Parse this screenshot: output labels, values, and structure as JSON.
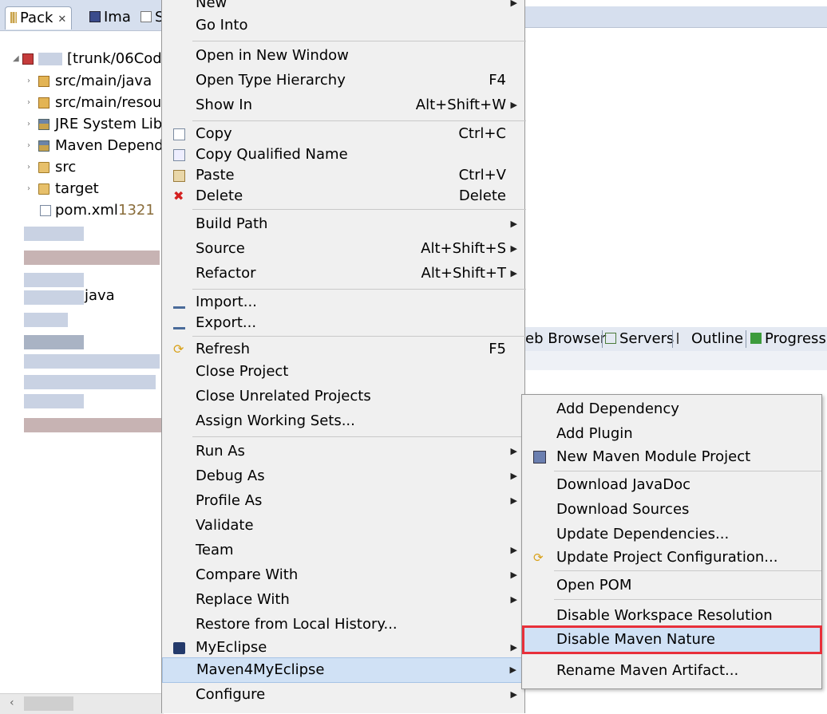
{
  "left_pane": {
    "tabs": [
      {
        "label": "Pack",
        "close": "✕"
      },
      {
        "label": "Ima"
      },
      {
        "label": "S"
      }
    ],
    "tree": [
      {
        "label": "[trunk/06Cod"
      },
      {
        "label": "src/main/java"
      },
      {
        "label": "src/main/resou"
      },
      {
        "label": "JRE System Libr"
      },
      {
        "label": "Maven Depend"
      },
      {
        "label": "src"
      },
      {
        "label": "target"
      },
      {
        "label": "pom.xml",
        "rev": "1321"
      }
    ],
    "blur_row_text": "java"
  },
  "context_menu": {
    "items": [
      {
        "label": "New"
      },
      {
        "label": "Go Into"
      },
      {
        "label": "Open in New Window"
      },
      {
        "label": "Open Type Hierarchy",
        "accel": "F4"
      },
      {
        "label": "Show In",
        "accel": "Alt+Shift+W"
      },
      {
        "label": "Copy",
        "accel": "Ctrl+C"
      },
      {
        "label": "Copy Qualified Name"
      },
      {
        "label": "Paste",
        "accel": "Ctrl+V"
      },
      {
        "label": "Delete",
        "accel": "Delete"
      },
      {
        "label": "Build Path"
      },
      {
        "label": "Source",
        "accel": "Alt+Shift+S"
      },
      {
        "label": "Refactor",
        "accel": "Alt+Shift+T"
      },
      {
        "label": "Import..."
      },
      {
        "label": "Export..."
      },
      {
        "label": "Refresh",
        "accel": "F5"
      },
      {
        "label": "Close Project"
      },
      {
        "label": "Close Unrelated Projects"
      },
      {
        "label": "Assign Working Sets..."
      },
      {
        "label": "Run As"
      },
      {
        "label": "Debug As"
      },
      {
        "label": "Profile As"
      },
      {
        "label": "Validate"
      },
      {
        "label": "Team"
      },
      {
        "label": "Compare With"
      },
      {
        "label": "Replace With"
      },
      {
        "label": "Restore from Local History..."
      },
      {
        "label": "MyEclipse"
      },
      {
        "label": "Maven4MyEclipse"
      },
      {
        "label": "Configure"
      }
    ],
    "submenu_arrow": "▶"
  },
  "submenu": {
    "items": [
      {
        "label": "Add Dependency"
      },
      {
        "label": "Add Plugin"
      },
      {
        "label": "New Maven Module Project"
      },
      {
        "label": "Download JavaDoc"
      },
      {
        "label": "Download Sources"
      },
      {
        "label": "Update Dependencies..."
      },
      {
        "label": "Update Project Configuration..."
      },
      {
        "label": "Open POM"
      },
      {
        "label": "Disable Workspace Resolution"
      },
      {
        "label": "Disable Maven Nature"
      },
      {
        "label": "Rename Maven Artifact..."
      }
    ]
  },
  "bottom_tabs": [
    {
      "label": "eb Browser"
    },
    {
      "label": "Servers"
    },
    {
      "label": "Outline"
    },
    {
      "label": "Progress"
    }
  ],
  "colors": {
    "highlight_border": "#e8303a",
    "selected_bg": "#d0e1f5"
  }
}
